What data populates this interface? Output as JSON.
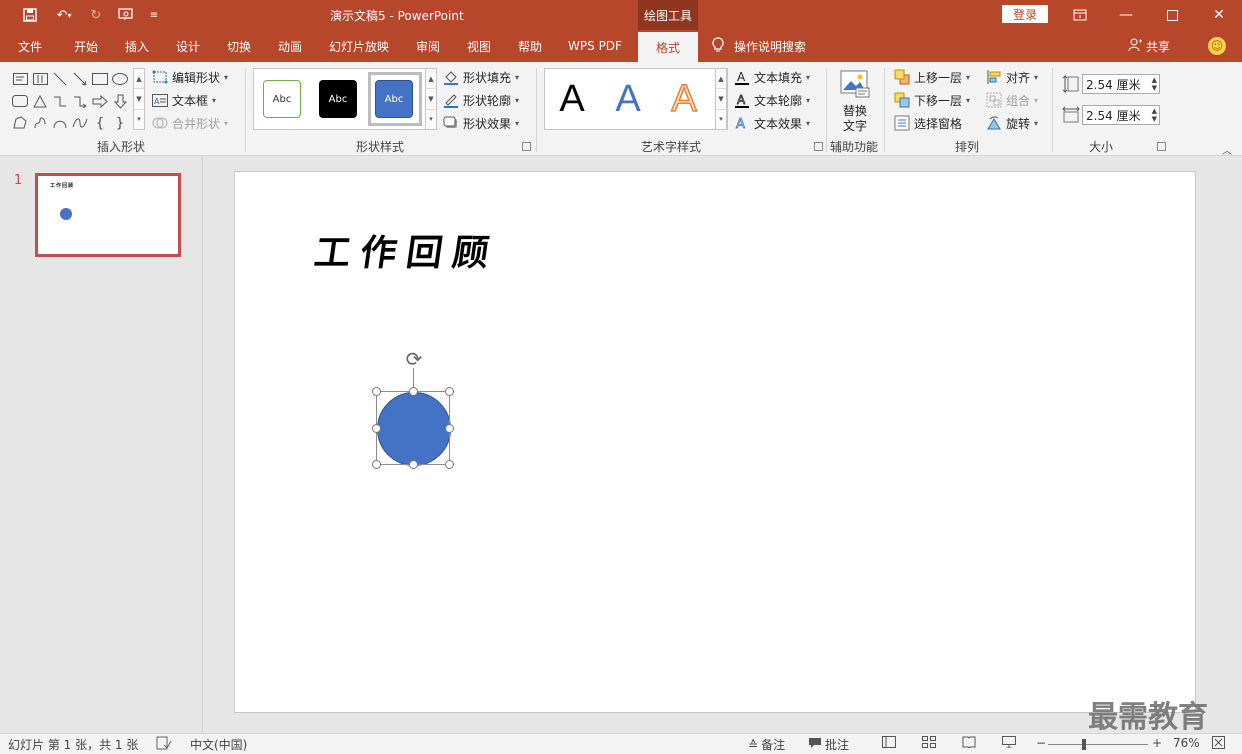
{
  "titlebar": {
    "doc_title": "演示文稿5  -  PowerPoint",
    "context_tab": "绘图工具",
    "login": "登录",
    "quick_access": [
      "save-icon",
      "undo-icon",
      "redo-icon",
      "start-from-beginning-icon",
      "customize-icon"
    ],
    "window_controls": [
      "ribbon-display-options-icon",
      "minimize-icon",
      "maximize-icon",
      "close-icon"
    ]
  },
  "tabs": [
    "文件",
    "开始",
    "插入",
    "设计",
    "切换",
    "动画",
    "幻灯片放映",
    "审阅",
    "视图",
    "帮助",
    "WPS PDF",
    "格式"
  ],
  "active_tab": "格式",
  "search_hint": "操作说明搜索",
  "share": "共享",
  "ribbon": {
    "insert_shapes": {
      "label": "插入形状",
      "edit_shape": "编辑形状",
      "text_box": "文本框",
      "merge_shapes": "合并形状"
    },
    "shape_styles": {
      "label": "形状样式",
      "swatches": [
        "Abc",
        "Abc",
        "Abc"
      ],
      "fill": "形状填充",
      "outline": "形状轮廓",
      "effects": "形状效果"
    },
    "wordart_styles": {
      "label": "艺术字样式",
      "samples": [
        "A",
        "A",
        "A"
      ],
      "text_fill": "文本填充",
      "text_outline": "文本轮廓",
      "text_effects": "文本效果"
    },
    "accessibility": {
      "label": "辅助功能",
      "alt_text_line1": "替换",
      "alt_text_line2": "文字"
    },
    "arrange": {
      "label": "排列",
      "bring_forward": "上移一层",
      "send_backward": "下移一层",
      "selection_pane": "选择窗格",
      "align": "对齐",
      "group": "组合",
      "rotate": "旋转"
    },
    "size": {
      "label": "大小",
      "height": "2.54 厘米",
      "width": "2.54 厘米"
    }
  },
  "thumbnails": [
    {
      "number": "1",
      "title": "工作回顾"
    }
  ],
  "slide": {
    "title": "工作回顾"
  },
  "statusbar": {
    "slide_info": "幻灯片 第 1 张，共 1 张",
    "language": "中文(中国)",
    "notes": "备注",
    "comments": "批注",
    "zoom_minus": "−",
    "zoom_plus": "+",
    "zoom": "76%"
  },
  "watermark": "最需教育",
  "colors": {
    "accent": "#b7472a",
    "shape_fill": "#4472c4",
    "thumbnail_border": "#c0504d"
  }
}
